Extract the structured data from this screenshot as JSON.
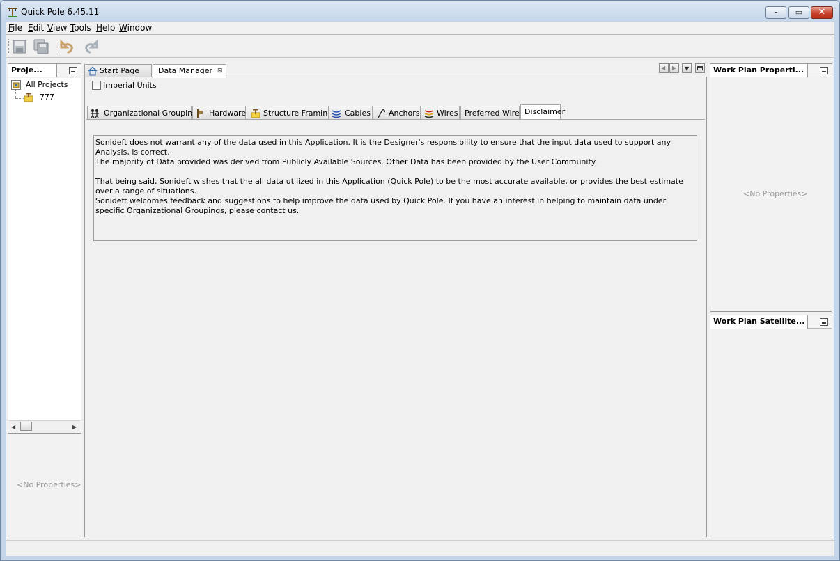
{
  "window": {
    "title": "Quick Pole 6.45.11",
    "controls": {
      "minimize": "–",
      "maximize": "▭",
      "close": "✕"
    }
  },
  "menu": [
    {
      "label": "File",
      "mnemonic": "F"
    },
    {
      "label": "Edit",
      "mnemonic": "E"
    },
    {
      "label": "View",
      "mnemonic": "V"
    },
    {
      "label": "Tools",
      "mnemonic": "T"
    },
    {
      "label": "Help",
      "mnemonic": "H"
    },
    {
      "label": "Window",
      "mnemonic": "W"
    }
  ],
  "toolbar": {
    "icons": [
      "save-icon",
      "save-all-icon",
      "undo-icon",
      "redo-icon"
    ]
  },
  "projects_panel": {
    "title": "Proje...",
    "tree": [
      {
        "label": "All Projects",
        "icon": "projects-folder-icon"
      },
      {
        "label": "777",
        "icon": "pole-project-icon"
      }
    ],
    "properties_placeholder": "<No Properties>"
  },
  "editor": {
    "tabs": [
      {
        "label": "Start Page",
        "icon": "home-icon",
        "active": false
      },
      {
        "label": "Data Manager",
        "icon": "",
        "active": true,
        "close": "⊠"
      }
    ],
    "imperial_units_label": "Imperial Units",
    "imperial_units_checked": false,
    "subtabs": [
      {
        "label": "Organizational Groupings",
        "icon": "people-icon"
      },
      {
        "label": "Hardware",
        "icon": "hardware-icon"
      },
      {
        "label": "Structure Framing",
        "icon": "framing-icon"
      },
      {
        "label": "Cables",
        "icon": "cables-icon"
      },
      {
        "label": "Anchors",
        "icon": "anchor-icon"
      },
      {
        "label": "Wires",
        "icon": "wires-icon"
      },
      {
        "label": "Preferred Wires",
        "icon": ""
      },
      {
        "label": "Disclaimer",
        "icon": "",
        "active": true
      }
    ],
    "disclaimer": [
      "Sonideft does not warrant any of the data used in this Application. It is the Designer's responsibility to ensure that the input data used to support any Analysis, is correct.",
      "The majority of Data provided was derived from Publicly Available Sources. Other Data has been provided by the User Community.",
      "That being said, Sonideft wishes that the all data utilized in this Application (Quick Pole) to be the most accurate available, or provides the best estimate over a range of situations.",
      "Sonideft welcomes feedback and suggestions to help improve the data used by Quick Pole. If you have an interest in helping to maintain data under specific Organizational Groupings, please contact us."
    ]
  },
  "work_plan_properties": {
    "title": "Work Plan Properti...",
    "placeholder": "<No Properties>"
  },
  "work_plan_satellite": {
    "title": "Work Plan Satellite..."
  },
  "colors": {
    "accent": "#3a6ea5",
    "close_button": "#c7412b"
  }
}
